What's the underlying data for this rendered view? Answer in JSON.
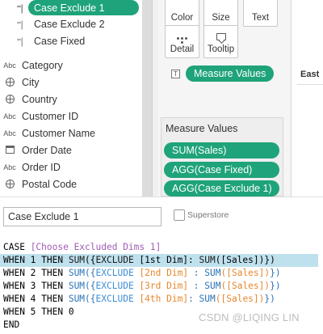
{
  "data_pane": {
    "calc_fields": [
      {
        "label": "Case Exclude 1",
        "icon": "calculated-field-icon",
        "selected": true
      },
      {
        "label": "Case Exclude 2",
        "icon": "calculated-field-icon",
        "selected": false
      },
      {
        "label": "Case Fixed",
        "icon": "calculated-field-icon",
        "selected": false
      }
    ],
    "dimensions": [
      {
        "label": "Category",
        "type": "Abc"
      },
      {
        "label": "City",
        "type": "geo"
      },
      {
        "label": "Country",
        "type": "geo"
      },
      {
        "label": "Customer ID",
        "type": "Abc"
      },
      {
        "label": "Customer Name",
        "type": "Abc"
      },
      {
        "label": "Order Date",
        "type": "date"
      },
      {
        "label": "Order ID",
        "type": "Abc"
      },
      {
        "label": "Postal Code",
        "type": "geo"
      }
    ],
    "calc_icon_glyph": "⁼|",
    "abc_glyph": "Abc",
    "accent_color": "#1fa37a"
  },
  "marks_card": {
    "buttons_row1": [
      {
        "label": "Color",
        "icon": "color-icon"
      },
      {
        "label": "Size",
        "icon": "size-icon"
      },
      {
        "label": "Text",
        "icon": "text-icon"
      }
    ],
    "buttons_row2": [
      {
        "label": "Detail",
        "icon": "detail-icon"
      },
      {
        "label": "Tooltip",
        "icon": "tooltip-icon"
      }
    ],
    "text_marker_glyph": "T",
    "measure_values_pill": "Measure Values",
    "measure_values_title": "Measure Values",
    "measure_pills": [
      "SUM(Sales)",
      "AGG(Case Fixed)",
      "AGG(Case Exclude 1)"
    ]
  },
  "view": {
    "header": "East"
  },
  "calc_editor": {
    "name": "Case Exclude 1",
    "datasource": "Superstore",
    "code": {
      "line1": {
        "kw": "CASE ",
        "param": "[Choose Excluded Dims 1]"
      },
      "line2": {
        "when": "WHEN 1 THEN ",
        "fn": "SUM",
        "open": "({",
        "ex": "EXCLUDE",
        "mid": " [1st Dim]: ",
        "fn2": "SUM",
        "fld": "([Sales])",
        "close": "})"
      },
      "line3": {
        "when": "WHEN 2 THEN ",
        "fn": "SUM",
        "open": "({",
        "ex": "EXCLUDE",
        "sp": " ",
        "dim": "[2nd Dim]",
        "colon": " : ",
        "fn2": "SUM",
        "fld": "([Sales])",
        "close": "})"
      },
      "line4": {
        "when": "WHEN 3 THEN ",
        "fn": "SUM",
        "open": "({",
        "ex": "EXCLUDE",
        "sp": " ",
        "dim": "[3rd Dim]",
        "colon": " : ",
        "fn2": "SUM",
        "fld": "([Sales])",
        "close": "})"
      },
      "line5": {
        "when": "WHEN 4 THEN ",
        "fn": "SUM",
        "open": "({",
        "ex": "EXCLUDE",
        "sp": " ",
        "dim": "[4th Dim]",
        "colon": ": ",
        "fn2": "SUM",
        "fld": "([Sales])",
        "close": "})"
      },
      "line6": {
        "text": "WHEN 5 THEN 0"
      },
      "line7": {
        "text": "END"
      }
    }
  },
  "watermark": "CSDN @LIQING LIN"
}
